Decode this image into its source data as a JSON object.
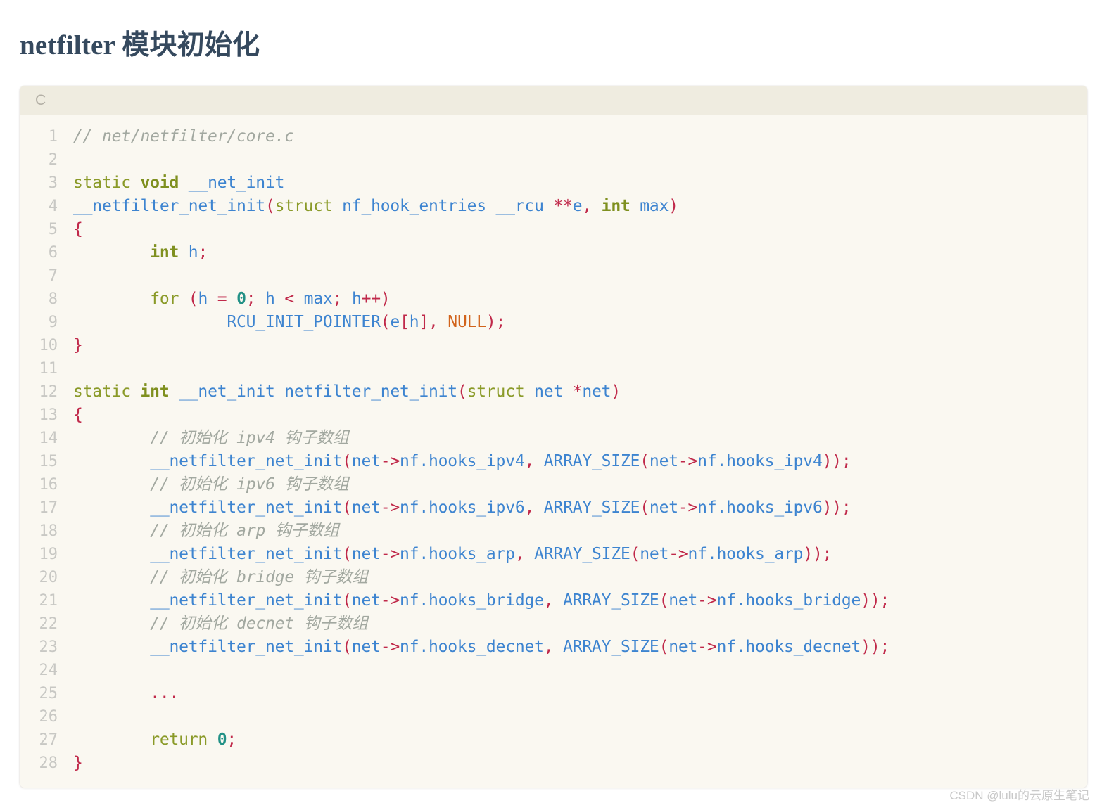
{
  "page": {
    "title": "netfilter 模块初始化",
    "background_color": "#ffffff",
    "title_color": "#35495e"
  },
  "code_block": {
    "language_label": "C",
    "header_background": "#efece0",
    "body_background": "#faf8f1",
    "line_number_color": "#c8c8c4",
    "token_colors": {
      "comment": "#a2a8a0",
      "keyword": "#8a9a28",
      "identifier": "#3d84d0",
      "punctuation": "#c0294a",
      "number": "#219186",
      "constant": "#d1631b",
      "plain": "#4a4a4a"
    },
    "line_count": 28,
    "lines": [
      {
        "n": "1",
        "tokens": [
          {
            "t": "// net/netfilter/core.c",
            "c": "t-com"
          }
        ]
      },
      {
        "n": "2",
        "tokens": []
      },
      {
        "n": "3",
        "tokens": [
          {
            "t": "static ",
            "c": "t-kw"
          },
          {
            "t": "void",
            "c": "t-kwb"
          },
          {
            "t": " ",
            "c": "t-plain"
          },
          {
            "t": "__net_init",
            "c": "t-id"
          }
        ]
      },
      {
        "n": "4",
        "tokens": [
          {
            "t": "__netfilter_net_init",
            "c": "t-fn"
          },
          {
            "t": "(",
            "c": "t-pun"
          },
          {
            "t": "struct",
            "c": "t-kw"
          },
          {
            "t": " ",
            "c": "t-plain"
          },
          {
            "t": "nf_hook_entries __rcu ",
            "c": "t-id"
          },
          {
            "t": "**",
            "c": "t-pun"
          },
          {
            "t": "e",
            "c": "t-id"
          },
          {
            "t": ",",
            "c": "t-pun"
          },
          {
            "t": " ",
            "c": "t-plain"
          },
          {
            "t": "int",
            "c": "t-kwb"
          },
          {
            "t": " ",
            "c": "t-plain"
          },
          {
            "t": "max",
            "c": "t-id"
          },
          {
            "t": ")",
            "c": "t-pun"
          }
        ]
      },
      {
        "n": "5",
        "tokens": [
          {
            "t": "{",
            "c": "t-pun"
          }
        ]
      },
      {
        "n": "6",
        "tokens": [
          {
            "t": "        ",
            "c": "t-plain"
          },
          {
            "t": "int",
            "c": "t-kwb"
          },
          {
            "t": " ",
            "c": "t-plain"
          },
          {
            "t": "h",
            "c": "t-id"
          },
          {
            "t": ";",
            "c": "t-pun"
          }
        ]
      },
      {
        "n": "7",
        "tokens": []
      },
      {
        "n": "8",
        "tokens": [
          {
            "t": "        ",
            "c": "t-plain"
          },
          {
            "t": "for",
            "c": "t-kw"
          },
          {
            "t": " ",
            "c": "t-plain"
          },
          {
            "t": "(",
            "c": "t-pun"
          },
          {
            "t": "h",
            "c": "t-id"
          },
          {
            "t": " ",
            "c": "t-plain"
          },
          {
            "t": "=",
            "c": "t-pun"
          },
          {
            "t": " ",
            "c": "t-plain"
          },
          {
            "t": "0",
            "c": "t-num"
          },
          {
            "t": ";",
            "c": "t-pun"
          },
          {
            "t": " ",
            "c": "t-plain"
          },
          {
            "t": "h",
            "c": "t-id"
          },
          {
            "t": " ",
            "c": "t-plain"
          },
          {
            "t": "<",
            "c": "t-pun"
          },
          {
            "t": " ",
            "c": "t-plain"
          },
          {
            "t": "max",
            "c": "t-id"
          },
          {
            "t": ";",
            "c": "t-pun"
          },
          {
            "t": " ",
            "c": "t-plain"
          },
          {
            "t": "h",
            "c": "t-id"
          },
          {
            "t": "++)",
            "c": "t-pun"
          }
        ]
      },
      {
        "n": "9",
        "tokens": [
          {
            "t": "                ",
            "c": "t-plain"
          },
          {
            "t": "RCU_INIT_POINTER",
            "c": "t-fn"
          },
          {
            "t": "(",
            "c": "t-pun"
          },
          {
            "t": "e",
            "c": "t-id"
          },
          {
            "t": "[",
            "c": "t-pun"
          },
          {
            "t": "h",
            "c": "t-id"
          },
          {
            "t": "],",
            "c": "t-pun"
          },
          {
            "t": " ",
            "c": "t-plain"
          },
          {
            "t": "NULL",
            "c": "t-const"
          },
          {
            "t": ");",
            "c": "t-pun"
          }
        ]
      },
      {
        "n": "10",
        "tokens": [
          {
            "t": "}",
            "c": "t-pun"
          }
        ]
      },
      {
        "n": "11",
        "tokens": []
      },
      {
        "n": "12",
        "tokens": [
          {
            "t": "static ",
            "c": "t-kw"
          },
          {
            "t": "int",
            "c": "t-kwb"
          },
          {
            "t": " ",
            "c": "t-plain"
          },
          {
            "t": "__net_init netfilter_net_init",
            "c": "t-id"
          },
          {
            "t": "(",
            "c": "t-pun"
          },
          {
            "t": "struct",
            "c": "t-kw"
          },
          {
            "t": " ",
            "c": "t-plain"
          },
          {
            "t": "net ",
            "c": "t-id"
          },
          {
            "t": "*",
            "c": "t-pun"
          },
          {
            "t": "net",
            "c": "t-id"
          },
          {
            "t": ")",
            "c": "t-pun"
          }
        ]
      },
      {
        "n": "13",
        "tokens": [
          {
            "t": "{",
            "c": "t-pun"
          }
        ]
      },
      {
        "n": "14",
        "tokens": [
          {
            "t": "        ",
            "c": "t-plain"
          },
          {
            "t": "// 初始化 ipv4 钩子数组",
            "c": "t-com"
          }
        ]
      },
      {
        "n": "15",
        "tokens": [
          {
            "t": "        ",
            "c": "t-plain"
          },
          {
            "t": "__netfilter_net_init",
            "c": "t-fn"
          },
          {
            "t": "(",
            "c": "t-pun"
          },
          {
            "t": "net",
            "c": "t-id"
          },
          {
            "t": "->",
            "c": "t-pun"
          },
          {
            "t": "nf.hooks_ipv4",
            "c": "t-id"
          },
          {
            "t": ",",
            "c": "t-pun"
          },
          {
            "t": " ",
            "c": "t-plain"
          },
          {
            "t": "ARRAY_SIZE",
            "c": "t-fn"
          },
          {
            "t": "(",
            "c": "t-pun"
          },
          {
            "t": "net",
            "c": "t-id"
          },
          {
            "t": "->",
            "c": "t-pun"
          },
          {
            "t": "nf.hooks_ipv4",
            "c": "t-id"
          },
          {
            "t": "));",
            "c": "t-pun"
          }
        ]
      },
      {
        "n": "16",
        "tokens": [
          {
            "t": "        ",
            "c": "t-plain"
          },
          {
            "t": "// 初始化 ipv6 钩子数组",
            "c": "t-com"
          }
        ]
      },
      {
        "n": "17",
        "tokens": [
          {
            "t": "        ",
            "c": "t-plain"
          },
          {
            "t": "__netfilter_net_init",
            "c": "t-fn"
          },
          {
            "t": "(",
            "c": "t-pun"
          },
          {
            "t": "net",
            "c": "t-id"
          },
          {
            "t": "->",
            "c": "t-pun"
          },
          {
            "t": "nf.hooks_ipv6",
            "c": "t-id"
          },
          {
            "t": ",",
            "c": "t-pun"
          },
          {
            "t": " ",
            "c": "t-plain"
          },
          {
            "t": "ARRAY_SIZE",
            "c": "t-fn"
          },
          {
            "t": "(",
            "c": "t-pun"
          },
          {
            "t": "net",
            "c": "t-id"
          },
          {
            "t": "->",
            "c": "t-pun"
          },
          {
            "t": "nf.hooks_ipv6",
            "c": "t-id"
          },
          {
            "t": "));",
            "c": "t-pun"
          }
        ]
      },
      {
        "n": "18",
        "tokens": [
          {
            "t": "        ",
            "c": "t-plain"
          },
          {
            "t": "// 初始化 arp 钩子数组",
            "c": "t-com"
          }
        ]
      },
      {
        "n": "19",
        "tokens": [
          {
            "t": "        ",
            "c": "t-plain"
          },
          {
            "t": "__netfilter_net_init",
            "c": "t-fn"
          },
          {
            "t": "(",
            "c": "t-pun"
          },
          {
            "t": "net",
            "c": "t-id"
          },
          {
            "t": "->",
            "c": "t-pun"
          },
          {
            "t": "nf.hooks_arp",
            "c": "t-id"
          },
          {
            "t": ",",
            "c": "t-pun"
          },
          {
            "t": " ",
            "c": "t-plain"
          },
          {
            "t": "ARRAY_SIZE",
            "c": "t-fn"
          },
          {
            "t": "(",
            "c": "t-pun"
          },
          {
            "t": "net",
            "c": "t-id"
          },
          {
            "t": "->",
            "c": "t-pun"
          },
          {
            "t": "nf.hooks_arp",
            "c": "t-id"
          },
          {
            "t": "));",
            "c": "t-pun"
          }
        ]
      },
      {
        "n": "20",
        "tokens": [
          {
            "t": "        ",
            "c": "t-plain"
          },
          {
            "t": "// 初始化 bridge 钩子数组",
            "c": "t-com"
          }
        ]
      },
      {
        "n": "21",
        "tokens": [
          {
            "t": "        ",
            "c": "t-plain"
          },
          {
            "t": "__netfilter_net_init",
            "c": "t-fn"
          },
          {
            "t": "(",
            "c": "t-pun"
          },
          {
            "t": "net",
            "c": "t-id"
          },
          {
            "t": "->",
            "c": "t-pun"
          },
          {
            "t": "nf.hooks_bridge",
            "c": "t-id"
          },
          {
            "t": ",",
            "c": "t-pun"
          },
          {
            "t": " ",
            "c": "t-plain"
          },
          {
            "t": "ARRAY_SIZE",
            "c": "t-fn"
          },
          {
            "t": "(",
            "c": "t-pun"
          },
          {
            "t": "net",
            "c": "t-id"
          },
          {
            "t": "->",
            "c": "t-pun"
          },
          {
            "t": "nf.hooks_bridge",
            "c": "t-id"
          },
          {
            "t": "));",
            "c": "t-pun"
          }
        ]
      },
      {
        "n": "22",
        "tokens": [
          {
            "t": "        ",
            "c": "t-plain"
          },
          {
            "t": "// 初始化 decnet 钩子数组",
            "c": "t-com"
          }
        ]
      },
      {
        "n": "23",
        "tokens": [
          {
            "t": "        ",
            "c": "t-plain"
          },
          {
            "t": "__netfilter_net_init",
            "c": "t-fn"
          },
          {
            "t": "(",
            "c": "t-pun"
          },
          {
            "t": "net",
            "c": "t-id"
          },
          {
            "t": "->",
            "c": "t-pun"
          },
          {
            "t": "nf.hooks_decnet",
            "c": "t-id"
          },
          {
            "t": ",",
            "c": "t-pun"
          },
          {
            "t": " ",
            "c": "t-plain"
          },
          {
            "t": "ARRAY_SIZE",
            "c": "t-fn"
          },
          {
            "t": "(",
            "c": "t-pun"
          },
          {
            "t": "net",
            "c": "t-id"
          },
          {
            "t": "->",
            "c": "t-pun"
          },
          {
            "t": "nf.hooks_decnet",
            "c": "t-id"
          },
          {
            "t": "));",
            "c": "t-pun"
          }
        ]
      },
      {
        "n": "24",
        "tokens": []
      },
      {
        "n": "25",
        "tokens": [
          {
            "t": "        ",
            "c": "t-plain"
          },
          {
            "t": "...",
            "c": "t-pun"
          }
        ]
      },
      {
        "n": "26",
        "tokens": []
      },
      {
        "n": "27",
        "tokens": [
          {
            "t": "        ",
            "c": "t-plain"
          },
          {
            "t": "return",
            "c": "t-kw"
          },
          {
            "t": " ",
            "c": "t-plain"
          },
          {
            "t": "0",
            "c": "t-num"
          },
          {
            "t": ";",
            "c": "t-pun"
          }
        ]
      },
      {
        "n": "28",
        "tokens": [
          {
            "t": "}",
            "c": "t-pun"
          }
        ]
      }
    ]
  },
  "watermark": {
    "text": "CSDN @lulu的云原生笔记"
  }
}
